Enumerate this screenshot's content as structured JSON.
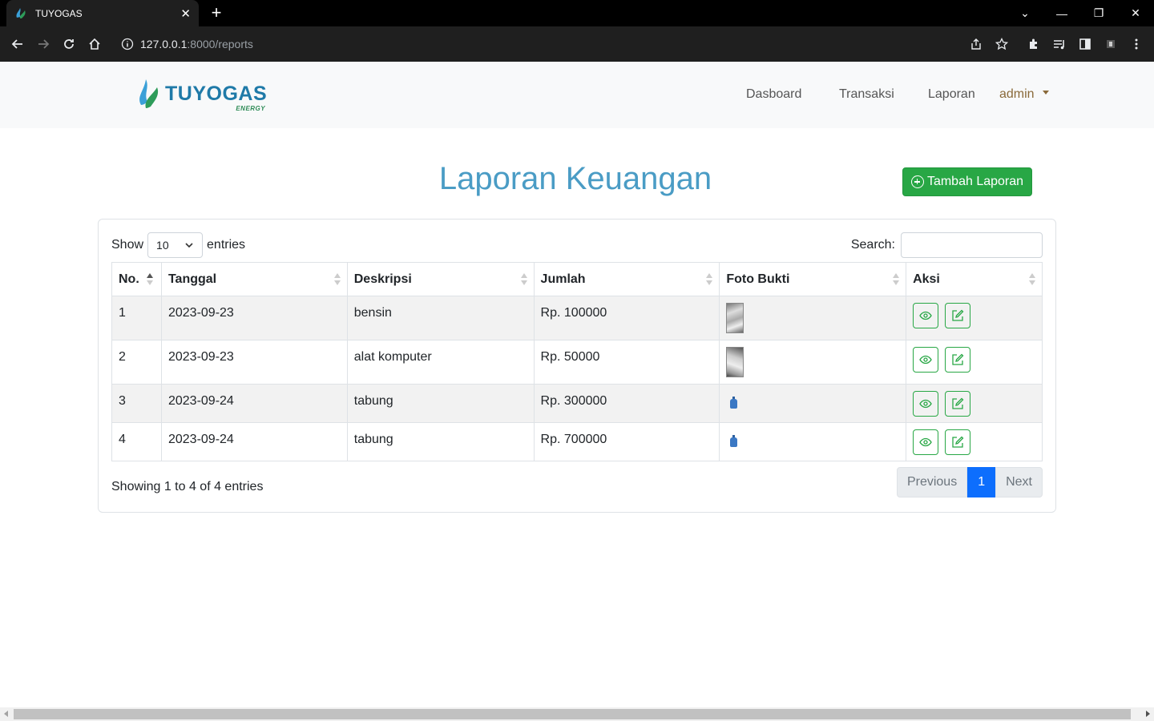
{
  "browser": {
    "tab_title": "TUYOGAS",
    "url_host": "127.0.0.1",
    "url_path": ":8000/reports"
  },
  "navbar": {
    "brand": "TUYOGAS",
    "brand_sub": "ENERGY",
    "links": [
      "Dasboard",
      "Transaksi",
      "Laporan"
    ],
    "user": "admin"
  },
  "main": {
    "title": "Laporan Keuangan",
    "add_button": "Tambah Laporan",
    "length": {
      "label_before": "Show",
      "value": "10",
      "label_after": "entries"
    },
    "search": {
      "label": "Search:",
      "value": ""
    },
    "columns": [
      "No.",
      "Tanggal",
      "Deskripsi",
      "Jumlah",
      "Foto Bukti",
      "Aksi"
    ],
    "rows": [
      {
        "no": "1",
        "tanggal": "2023-09-23",
        "deskripsi": "bensin",
        "jumlah": "Rp. 100000",
        "foto": "photo"
      },
      {
        "no": "2",
        "tanggal": "2023-09-23",
        "deskripsi": "alat komputer",
        "jumlah": "Rp. 50000",
        "foto": "photo"
      },
      {
        "no": "3",
        "tanggal": "2023-09-24",
        "deskripsi": "tabung",
        "jumlah": "Rp. 300000",
        "foto": "gas-icon"
      },
      {
        "no": "4",
        "tanggal": "2023-09-24",
        "deskripsi": "tabung",
        "jumlah": "Rp. 700000",
        "foto": "gas-icon"
      }
    ],
    "info": "Showing 1 to 4 of 4 entries",
    "pagination": {
      "previous": "Previous",
      "current": "1",
      "next": "Next"
    }
  },
  "colors": {
    "title": "#4a9cc5",
    "add_button": "#28a745",
    "page_active": "#0d6efd"
  }
}
